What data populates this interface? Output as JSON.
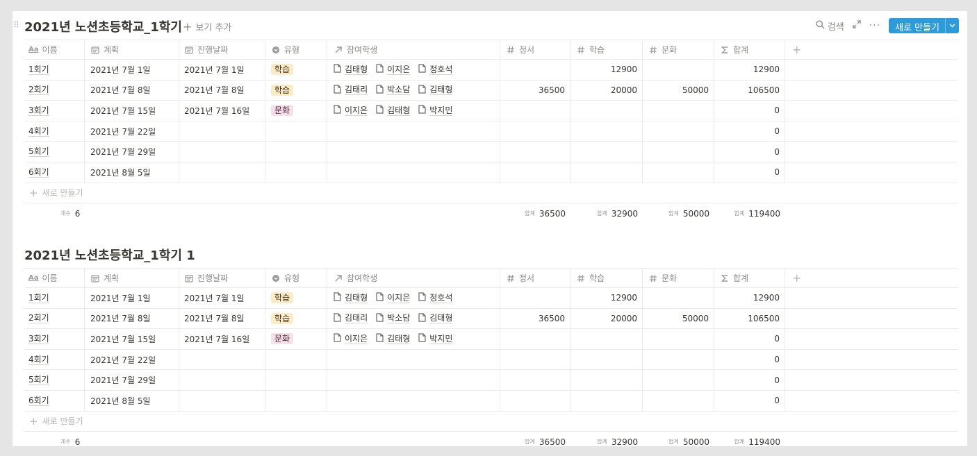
{
  "header": {
    "add_view_label": "보기 추가",
    "search_label": "검색",
    "new_button_label": "새로 만들기"
  },
  "columns": {
    "name": "이름",
    "name_icon_text": "Aa",
    "plan": "계획",
    "progress": "진행날짜",
    "type": "유형",
    "participants": "참여학생",
    "emotion": "정서",
    "study": "학습",
    "culture": "문화",
    "sum": "합계"
  },
  "colors": {
    "accent": "#2c9bd8",
    "tag_study_bg": "#fbecc8",
    "tag_culture_bg": "#f5e0e9"
  },
  "databases": [
    {
      "title": "2021년 노션초등학교_1학기",
      "new_row_label": "새로 만들기",
      "calc": {
        "count_label": "개수",
        "count": "6",
        "sum_label": "합계",
        "emotion": "36500",
        "study": "32900",
        "culture": "50000",
        "sum": "119400"
      },
      "rows": [
        {
          "name": "1회기",
          "plan": "2021년 7월 1일",
          "progress": "2021년 7월 1일",
          "type": "학습",
          "type_kind": "study",
          "participants": [
            "김태형",
            "이지은",
            "정호석"
          ],
          "emotion": "",
          "study": "12900",
          "culture": "",
          "sum": "12900"
        },
        {
          "name": "2회기",
          "plan": "2021년 7월 8일",
          "progress": "2021년 7월 8일",
          "type": "학습",
          "type_kind": "study",
          "participants": [
            "김태리",
            "박소담",
            "김태형"
          ],
          "emotion": "36500",
          "study": "20000",
          "culture": "50000",
          "sum": "106500"
        },
        {
          "name": "3회기",
          "plan": "2021년 7월 15일",
          "progress": "2021년 7월 16일",
          "type": "문화",
          "type_kind": "culture",
          "participants": [
            "이지은",
            "김태형",
            "박지민"
          ],
          "emotion": "",
          "study": "",
          "culture": "",
          "sum": "0"
        },
        {
          "name": "4회기",
          "plan": "2021년 7월 22일",
          "progress": "",
          "type": "",
          "type_kind": "",
          "participants": [],
          "emotion": "",
          "study": "",
          "culture": "",
          "sum": "0"
        },
        {
          "name": "5회기",
          "plan": "2021년 7월 29일",
          "progress": "",
          "type": "",
          "type_kind": "",
          "participants": [],
          "emotion": "",
          "study": "",
          "culture": "",
          "sum": "0"
        },
        {
          "name": "6회기",
          "plan": "2021년 8월 5일",
          "progress": "",
          "type": "",
          "type_kind": "",
          "participants": [],
          "emotion": "",
          "study": "",
          "culture": "",
          "sum": "0"
        }
      ]
    },
    {
      "title": "2021년 노션초등학교_1학기 1",
      "new_row_label": "새로 만들기",
      "calc": {
        "count_label": "개수",
        "count": "6",
        "sum_label": "합계",
        "emotion": "36500",
        "study": "32900",
        "culture": "50000",
        "sum": "119400"
      },
      "rows": [
        {
          "name": "1회기",
          "plan": "2021년 7월 1일",
          "progress": "2021년 7월 1일",
          "type": "학습",
          "type_kind": "study",
          "participants": [
            "김태형",
            "이지은",
            "정호석"
          ],
          "emotion": "",
          "study": "12900",
          "culture": "",
          "sum": "12900"
        },
        {
          "name": "2회기",
          "plan": "2021년 7월 8일",
          "progress": "2021년 7월 8일",
          "type": "학습",
          "type_kind": "study",
          "participants": [
            "김태리",
            "박소담",
            "김태형"
          ],
          "emotion": "36500",
          "study": "20000",
          "culture": "50000",
          "sum": "106500"
        },
        {
          "name": "3회기",
          "plan": "2021년 7월 15일",
          "progress": "2021년 7월 16일",
          "type": "문화",
          "type_kind": "culture",
          "participants": [
            "이지은",
            "김태형",
            "박지민"
          ],
          "emotion": "",
          "study": "",
          "culture": "",
          "sum": "0"
        },
        {
          "name": "4회기",
          "plan": "2021년 7월 22일",
          "progress": "",
          "type": "",
          "type_kind": "",
          "participants": [],
          "emotion": "",
          "study": "",
          "culture": "",
          "sum": "0"
        },
        {
          "name": "5회기",
          "plan": "2021년 7월 29일",
          "progress": "",
          "type": "",
          "type_kind": "",
          "participants": [],
          "emotion": "",
          "study": "",
          "culture": "",
          "sum": "0"
        },
        {
          "name": "6회기",
          "plan": "2021년 8월 5일",
          "progress": "",
          "type": "",
          "type_kind": "",
          "participants": [],
          "emotion": "",
          "study": "",
          "culture": "",
          "sum": "0"
        }
      ]
    }
  ]
}
